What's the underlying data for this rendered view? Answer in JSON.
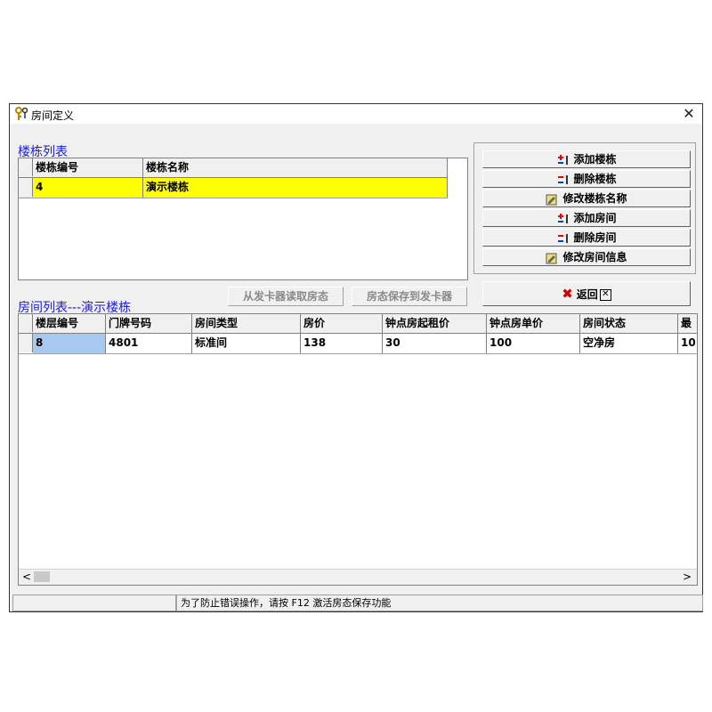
{
  "window": {
    "title": "房间定义",
    "close_glyph": "✕"
  },
  "building_section": {
    "label": "楼栋列表",
    "columns": [
      "楼栋编号",
      "楼栋名称"
    ],
    "rows": [
      {
        "id": "4",
        "name": "演示楼栋"
      }
    ]
  },
  "buttons": {
    "add_building": "添加楼栋",
    "delete_building": "删除楼栋",
    "rename_building": "修改楼栋名称",
    "add_room": "添加房间",
    "delete_room": "删除房间",
    "edit_room": "修改房间信息",
    "read_status": "从发卡器读取房态",
    "save_status": "房态保存到发卡器",
    "back": "返回",
    "back_icon": "red-x-icon"
  },
  "room_section": {
    "label": "房间列表---演示楼栋",
    "columns": [
      "楼层编号",
      "门牌号码",
      "房间类型",
      "房价",
      "钟点房起租价",
      "钟点房单价",
      "房间状态",
      "最"
    ],
    "rows": [
      {
        "floor": "8",
        "door": "4801",
        "type": "标准间",
        "price": "138",
        "hourly_start": "30",
        "hourly_unit": "100",
        "status": "空净房",
        "extra": "10"
      }
    ]
  },
  "scroll": {
    "left": "<",
    "right": ">"
  },
  "statusbar": {
    "message": "为了防止错误操作，请按 F12 激活房态保存功能"
  },
  "colors": {
    "selected_row": "#ffff00",
    "selected_cell": "#a8c8f0",
    "label_blue": "#1a1ae6"
  }
}
